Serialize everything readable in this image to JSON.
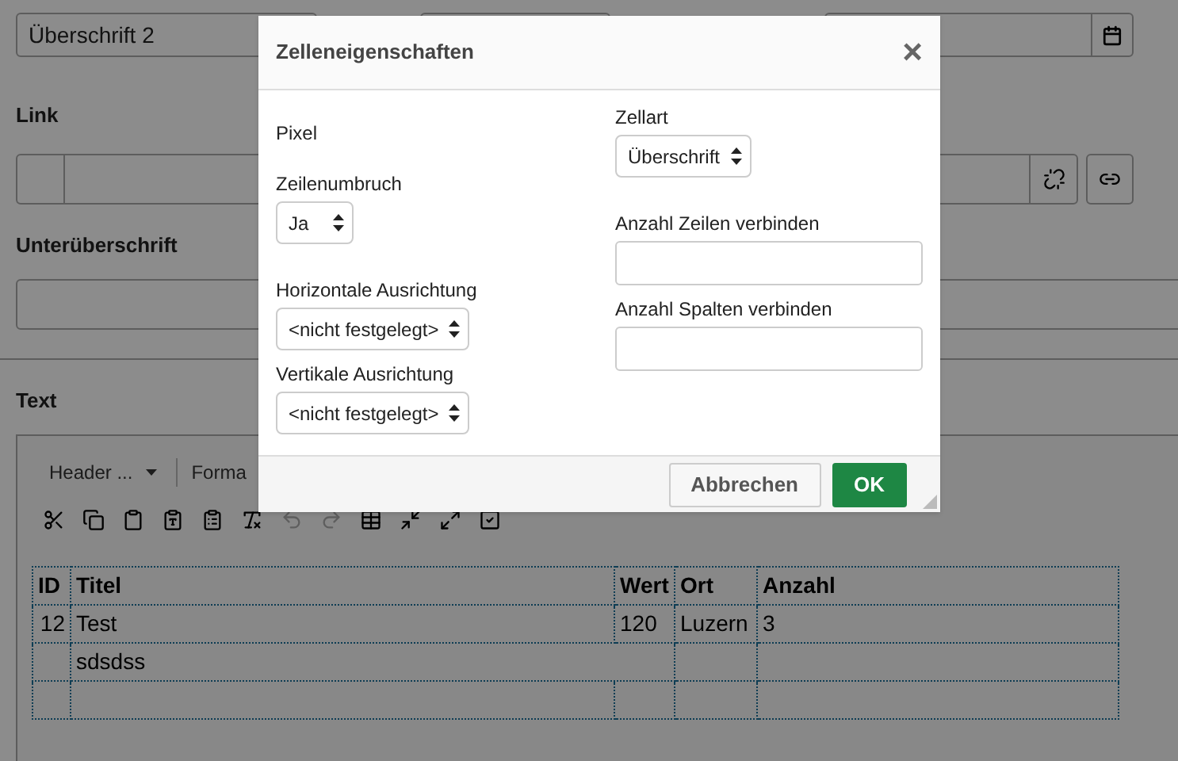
{
  "form": {
    "heading_value": "Überschrift 2",
    "link_label": "Link",
    "subheading_label": "Unterüberschrift",
    "text_label": "Text"
  },
  "editor": {
    "style_dropdown": "Header ...",
    "format_dropdown": "Forma",
    "toolbar": [
      {
        "disabled": false
      },
      {
        "disabled": false
      },
      {
        "disabled": false
      },
      {
        "disabled": false
      },
      {
        "disabled": false
      },
      {
        "disabled": false
      },
      {
        "disabled": true
      },
      {
        "disabled": true
      },
      {
        "disabled": false
      },
      {
        "disabled": false
      },
      {
        "disabled": false
      },
      {
        "disabled": false
      }
    ],
    "table": {
      "columns": [
        "ID",
        "Titel",
        "Wert",
        "Ort",
        "Anzahl"
      ],
      "rows": [
        {
          "cells": [
            {
              "text": "12"
            },
            {
              "text": "Test"
            },
            {
              "text": "120"
            },
            {
              "text": "Luzern"
            },
            {
              "text": "3"
            }
          ]
        },
        {
          "cells": [
            {
              "text": ""
            },
            {
              "text": "sdsdss",
              "colspan": 2
            },
            {
              "text": ""
            },
            {
              "text": ""
            }
          ]
        },
        {
          "cells": [
            {
              "text": ""
            },
            {
              "text": ""
            },
            {
              "text": ""
            },
            {
              "text": ""
            },
            {
              "text": ""
            }
          ]
        }
      ]
    }
  },
  "dialog": {
    "title": "Zelleneigenschaften",
    "close": "×",
    "left": [
      {
        "kind": "text",
        "label": "Pixel"
      },
      {
        "kind": "select",
        "label": "Zeilenumbruch",
        "value": "Ja"
      },
      {
        "kind": "select",
        "label": "Horizontale Ausrichtung",
        "value": "<nicht festgelegt>"
      },
      {
        "kind": "select",
        "label": "Vertikale Ausrichtung",
        "value": "<nicht festgelegt>"
      }
    ],
    "right": [
      {
        "kind": "select",
        "label": "Zellart",
        "value": "Überschrift"
      },
      {
        "kind": "input",
        "label": "Anzahl Zeilen verbinden"
      },
      {
        "kind": "input",
        "label": "Anzahl Spalten verbinden"
      }
    ],
    "buttons": [
      {
        "label": "Abbrechen",
        "kind": "secondary"
      },
      {
        "label": "OK",
        "kind": "primary"
      }
    ]
  }
}
